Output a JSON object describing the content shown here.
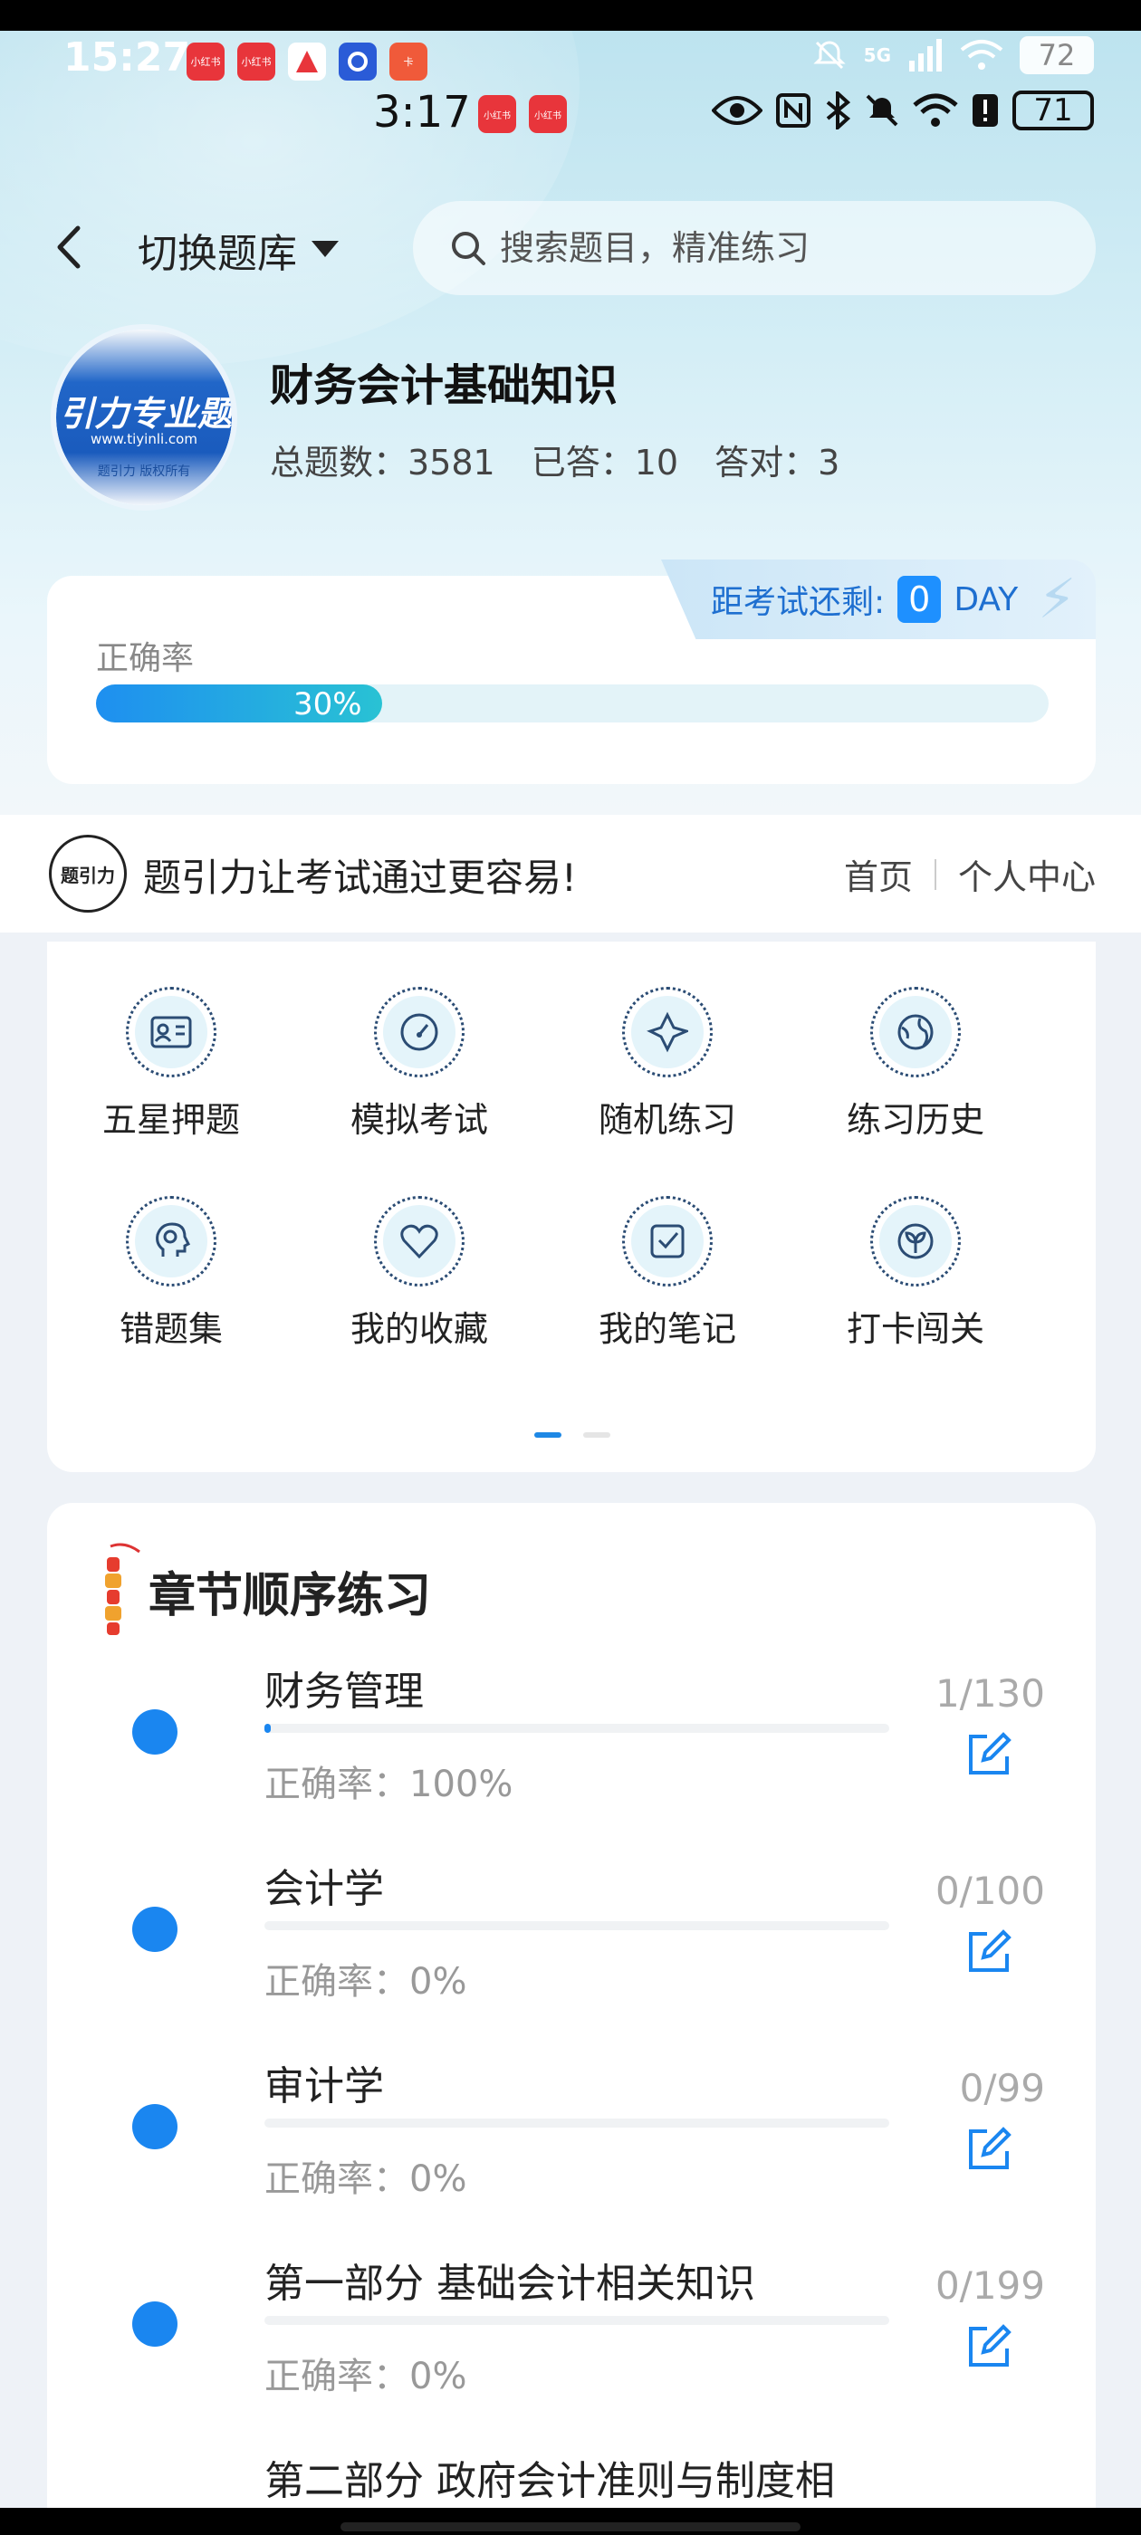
{
  "status_bar_outer": {
    "time": "15:27",
    "battery": "72",
    "network": "5G"
  },
  "status_bar_inner": {
    "time": "3:17",
    "battery": "71"
  },
  "app_icons": [
    "小红书",
    "小红书",
    "",
    "",
    "卡"
  ],
  "inner_app_icons": [
    "小红书",
    "小红书"
  ],
  "nav": {
    "switch_label": "切换题库",
    "search_placeholder": "搜索题目，精准练习"
  },
  "bank": {
    "title": "财务会计基础知识",
    "logo_text": "引力专业题",
    "logo_url": "www.tiyinli.com",
    "logo_copyright": "题引力 版权所有",
    "stats": {
      "total_label": "总题数：",
      "total": "3581",
      "answered_label": "已答：",
      "answered": "10",
      "correct_label": "答对：",
      "correct": "3"
    }
  },
  "accuracy": {
    "label": "正确率",
    "percent_text": "30%",
    "percent": 30,
    "countdown_label": "距考试还剩:",
    "countdown_value": "0",
    "countdown_unit": "DAY"
  },
  "ad": {
    "logo_text": "题引力",
    "text": "题引力让考试通过更容易!",
    "link_home": "首页",
    "link_profile": "个人中心"
  },
  "grid": [
    {
      "label": "五星押题",
      "icon": "id-card-icon"
    },
    {
      "label": "模拟考试",
      "icon": "speedometer-icon"
    },
    {
      "label": "随机练习",
      "icon": "random-icon"
    },
    {
      "label": "练习历史",
      "icon": "globe-icon"
    },
    {
      "label": "错题集",
      "icon": "head-icon"
    },
    {
      "label": "我的收藏",
      "icon": "heart-icon"
    },
    {
      "label": "我的笔记",
      "icon": "note-check-icon"
    },
    {
      "label": "打卡闯关",
      "icon": "sprout-icon"
    }
  ],
  "chapters": {
    "title": "章节顺序练习",
    "items": [
      {
        "name": "财务管理",
        "accuracy": "正确率：100%",
        "count": "1/130",
        "progress": 0.0077
      },
      {
        "name": "会计学",
        "accuracy": "正确率：0%",
        "count": "0/100",
        "progress": 0
      },
      {
        "name": "审计学",
        "accuracy": "正确率：0%",
        "count": "0/99",
        "progress": 0
      },
      {
        "name": "第一部分 基础会计相关知识",
        "accuracy": "正确率：0%",
        "count": "0/199",
        "progress": 0
      },
      {
        "name": "第二部分 政府会计准则与制度相",
        "accuracy": "",
        "count": "",
        "progress": 0
      }
    ]
  },
  "colors": {
    "accent": "#1a86f0",
    "bar_start": "#1e8ff0",
    "bar_end": "#29c2d4"
  }
}
